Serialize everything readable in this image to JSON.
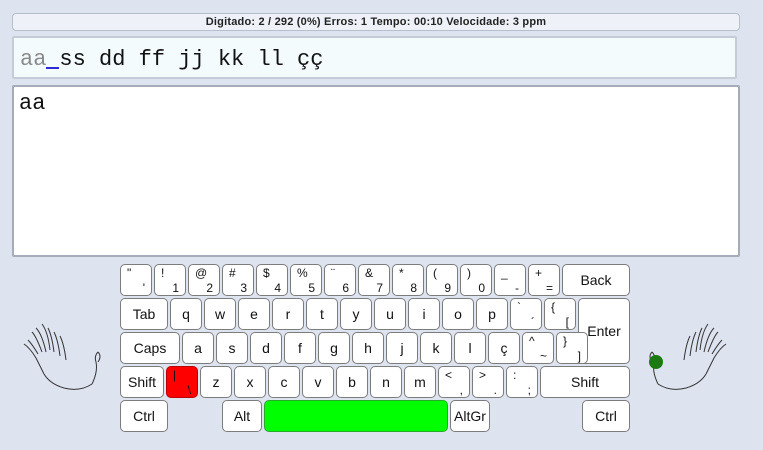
{
  "status": "Digitado: 2 / 292 (0%) Erros: 1 Tempo: 00:10 Velocidade: 3 ppm",
  "lesson": {
    "typed": "aa",
    "remaining": "ss dd ff jj kk ll çç"
  },
  "answer": "aa",
  "keyboard": {
    "row1": [
      {
        "top": "\"",
        "bottom": "'"
      },
      {
        "top": "!",
        "bottom": "1"
      },
      {
        "top": "@",
        "bottom": "2"
      },
      {
        "top": "#",
        "bottom": "3"
      },
      {
        "top": "$",
        "bottom": "4"
      },
      {
        "top": "%",
        "bottom": "5"
      },
      {
        "top": "¨",
        "bottom": "6"
      },
      {
        "top": "&",
        "bottom": "7"
      },
      {
        "top": "*",
        "bottom": "8"
      },
      {
        "top": "(",
        "bottom": "9"
      },
      {
        "top": ")",
        "bottom": "0"
      },
      {
        "top": "_",
        "bottom": "-"
      },
      {
        "top": "+",
        "bottom": "="
      }
    ],
    "back": "Back",
    "tab": "Tab",
    "row2": [
      "q",
      "w",
      "e",
      "r",
      "t",
      "y",
      "u",
      "i",
      "o",
      "p"
    ],
    "row2b": [
      {
        "top": "`",
        "bottom": "´"
      },
      {
        "top": "{",
        "bottom": "["
      }
    ],
    "enter": "Enter",
    "caps": "Caps",
    "row3": [
      "a",
      "s",
      "d",
      "f",
      "g",
      "h",
      "j",
      "k",
      "l",
      "ç"
    ],
    "row3b": [
      {
        "top": "^",
        "bottom": "~"
      },
      {
        "top": "}",
        "bottom": "]"
      }
    ],
    "shift_left": "Shift",
    "iso_key": {
      "top": "|",
      "bottom": "\\"
    },
    "row4": [
      "z",
      "x",
      "c",
      "v",
      "b",
      "n",
      "m"
    ],
    "row4b": [
      {
        "top": "<",
        "bottom": ","
      },
      {
        "top": ">",
        "bottom": "."
      },
      {
        "top": ":",
        "bottom": ";"
      }
    ],
    "shift_right": "Shift",
    "ctrl_left": "Ctrl",
    "alt": "Alt",
    "altgr": "AltGr",
    "ctrl_right": "Ctrl"
  },
  "colors": {
    "error_key": "#ff0000",
    "next_key": "#00ff00",
    "finger_dot": "#1b7a12"
  }
}
